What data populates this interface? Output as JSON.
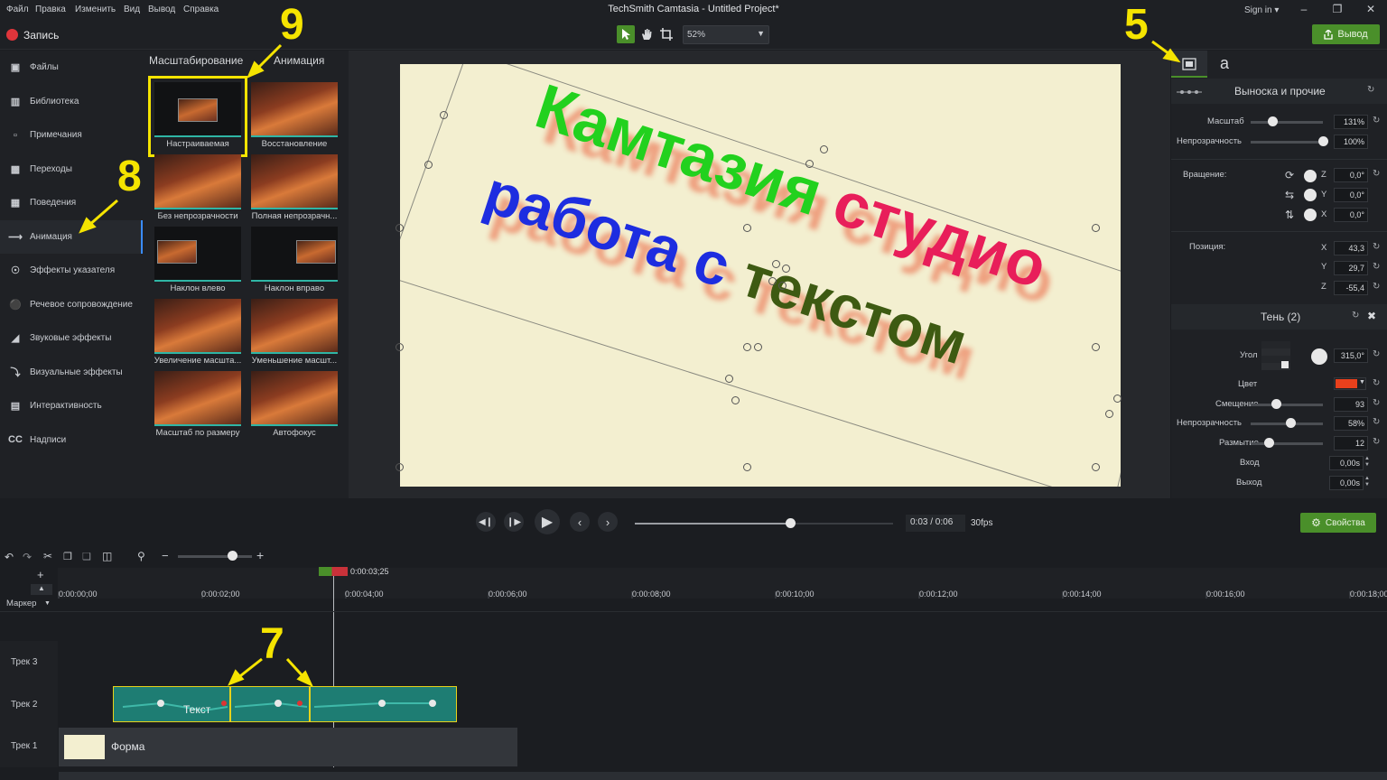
{
  "menu": [
    "Файл",
    "Правка",
    "Изменить",
    "Вид",
    "Вывод",
    "Справка"
  ],
  "app_title": "TechSmith Camtasia - Untitled Project*",
  "signin": "Sign in ▾",
  "toolbar": {
    "record_label": "Запись",
    "zoom": "52%",
    "export_label": "Вывод"
  },
  "left_nav": [
    {
      "label": "Файлы",
      "icon": "film-icon"
    },
    {
      "label": "Библиотека",
      "icon": "library-icon"
    },
    {
      "label": "Примечания",
      "icon": "callout-icon"
    },
    {
      "label": "Переходы",
      "icon": "transition-icon"
    },
    {
      "label": "Поведения",
      "icon": "behavior-icon"
    },
    {
      "label": "Анимация",
      "icon": "animation-icon"
    },
    {
      "label": "Эффекты указателя",
      "icon": "cursor-effects-icon"
    },
    {
      "label": "Речевое сопровождение",
      "icon": "microphone-icon"
    },
    {
      "label": "Звуковые эффекты",
      "icon": "speaker-icon"
    },
    {
      "label": "Визуальные эффекты",
      "icon": "wand-icon"
    },
    {
      "label": "Интерактивность",
      "icon": "interactive-icon"
    },
    {
      "label": "Надписи",
      "icon": "cc-icon"
    }
  ],
  "bin": {
    "tabs": [
      "Масштабирование",
      "Анимация"
    ],
    "thumbs": [
      {
        "label": "Настраиваемая"
      },
      {
        "label": "Восстановление"
      },
      {
        "label": "Без непрозрачности"
      },
      {
        "label": "Полная непрозрачн..."
      },
      {
        "label": "Наклон влево"
      },
      {
        "label": "Наклон вправо"
      },
      {
        "label": "Увеличение масшта..."
      },
      {
        "label": "Уменьшение масшт..."
      },
      {
        "label": "Масштаб по размеру"
      },
      {
        "label": "Автофокус"
      }
    ]
  },
  "canvas_text": {
    "line1a": "Камтазия",
    "line1b": "студио",
    "line2a": "работа",
    "line2b": "с",
    "line2c": "текстом"
  },
  "props": {
    "section_title": "Выноска и прочие",
    "scale_label": "Масштаб",
    "scale_value": "131%",
    "scale_level": 0.3,
    "opacity_label": "Непрозрачность",
    "opacity_value": "100%",
    "opacity_level": 1.0,
    "rotation_label": "Вращение:",
    "rot_z": "0,0°",
    "rot_y": "0,0°",
    "rot_x": "0,0°",
    "axis_z": "Z",
    "axis_y": "Y",
    "axis_x": "X",
    "position_label": "Позиция:",
    "pos_x": "43,3",
    "pos_y": "29,7",
    "pos_z": "-55,4",
    "shadow_title": "Тень (2)",
    "angle_label": "Угол",
    "angle_value": "315,0°",
    "color_label": "Цвет",
    "shadow_color": "#e8401c",
    "offset_label": "Смещение",
    "offset_value": "93",
    "offset_level": 0.35,
    "sh_opacity_label": "Непрозрачность",
    "sh_opacity_value": "58%",
    "sh_opacity_level": 0.55,
    "blur_label": "Размытие",
    "blur_value": "12",
    "blur_level": 0.25,
    "in_label": "Вход",
    "in_value": "0,00s",
    "out_label": "Выход",
    "out_value": "0,00s"
  },
  "player": {
    "time": "0:03 / 0:06",
    "fps": "30fps",
    "properties_label": "Свойства",
    "progress": 0.6
  },
  "timeline": {
    "playhead": "0:00:03;25",
    "marker_label": "Маркер",
    "ruler": [
      "0:00:00;00",
      "0:00:02;00",
      "0:00:04;00",
      "0:00:06;00",
      "0:00:08;00",
      "0:00:10;00",
      "0:00:12;00",
      "0:00:14;00",
      "0:00:16;00",
      "0:00:18;00"
    ],
    "tracks": [
      "Трек 3",
      "Трек 2",
      "Трек 1"
    ],
    "clip_text": "Текст",
    "clip_shape": "Форма"
  },
  "annotations": {
    "n9": "9",
    "n8": "8",
    "n5": "5",
    "n7": "7"
  },
  "colors": {
    "accent_green": "#4a8f2a",
    "highlight": "#f5e400",
    "text_green": "#22d11e",
    "text_red": "#e81e5a",
    "text_blue": "#1d2de0",
    "text_olive": "#3e5a12"
  }
}
